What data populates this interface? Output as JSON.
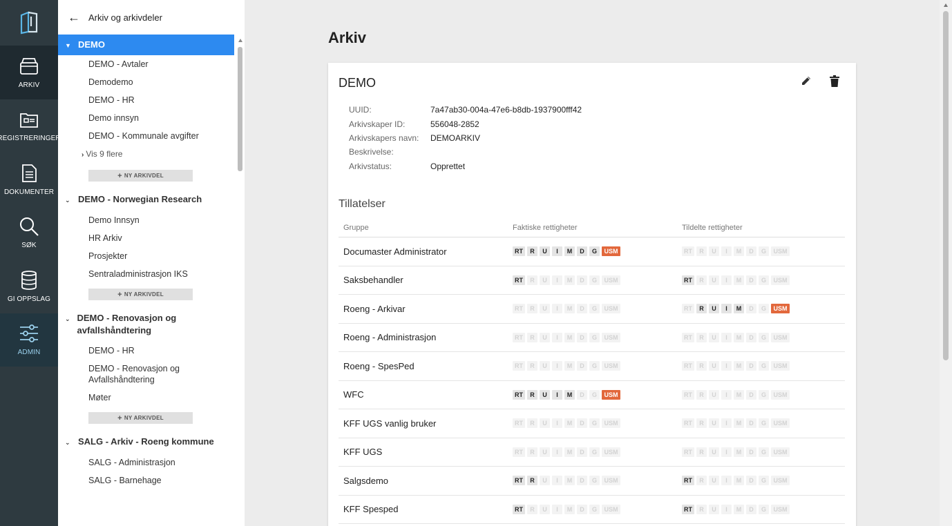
{
  "rail": {
    "items": [
      {
        "label": "ARKIV",
        "icon": "archive-box-icon"
      },
      {
        "label": "REGISTRERINGER",
        "icon": "folder-doc-icon"
      },
      {
        "label": "DOKUMENTER",
        "icon": "document-icon"
      },
      {
        "label": "SØK",
        "icon": "search-icon"
      },
      {
        "label": "GI OPPSLAG",
        "icon": "database-icon"
      },
      {
        "label": "ADMIN",
        "icon": "sliders-icon"
      }
    ]
  },
  "tree": {
    "header": "Arkiv og arkivdeler",
    "new_label": "NY ARKIVDEL",
    "groups": [
      {
        "title": "DEMO",
        "items": [
          "DEMO - Avtaler",
          "Demodemo",
          "DEMO - HR",
          "Demo innsyn",
          "DEMO - Kommunale avgifter"
        ],
        "more": "Vis 9 flere"
      },
      {
        "title": "DEMO - Norwegian Research",
        "items": [
          "Demo Innsyn",
          "HR Arkiv",
          "Prosjekter",
          "Sentraladministrasjon IKS"
        ]
      },
      {
        "title": "DEMO - Renovasjon og avfallshåndtering",
        "items": [
          "DEMO - HR",
          "DEMO - Renovasjon og Avfallshåndtering",
          "Møter"
        ]
      },
      {
        "title": "SALG - Arkiv - Roeng kommune",
        "items": [
          "SALG - Administrasjon",
          "SALG - Barnehage"
        ]
      }
    ]
  },
  "main": {
    "page_title": "Arkiv",
    "card_title": "DEMO",
    "meta": [
      {
        "key": "UUID:",
        "value": "7a47ab30-004a-47e6-b8db-1937900fff42"
      },
      {
        "key": "Arkivskaper ID:",
        "value": "556048-2852"
      },
      {
        "key": "Arkivskapers navn:",
        "value": "DEMOARKIV"
      },
      {
        "key": "Beskrivelse:",
        "value": ""
      },
      {
        "key": "Arkivstatus:",
        "value": "Opprettet"
      }
    ],
    "permissions_title": "Tillatelser",
    "columns": [
      "Gruppe",
      "Faktiske rettigheter",
      "Tildelte rettigheter"
    ],
    "badge_labels": [
      "RT",
      "R",
      "U",
      "I",
      "M",
      "D",
      "G",
      "USM"
    ],
    "rows": [
      {
        "group": "Documaster Administrator",
        "actual": [
          1,
          1,
          1,
          1,
          1,
          1,
          1,
          1
        ],
        "assigned": [
          0,
          0,
          0,
          0,
          0,
          0,
          0,
          0
        ]
      },
      {
        "group": "Saksbehandler",
        "actual": [
          1,
          0,
          0,
          0,
          0,
          0,
          0,
          0
        ],
        "assigned": [
          1,
          0,
          0,
          0,
          0,
          0,
          0,
          0
        ]
      },
      {
        "group": "Roeng - Arkivar",
        "actual": [
          0,
          0,
          0,
          0,
          0,
          0,
          0,
          0
        ],
        "assigned": [
          0,
          1,
          1,
          1,
          1,
          0,
          0,
          1
        ]
      },
      {
        "group": "Roeng - Administrasjon",
        "actual": [
          0,
          0,
          0,
          0,
          0,
          0,
          0,
          0
        ],
        "assigned": [
          0,
          0,
          0,
          0,
          0,
          0,
          0,
          0
        ]
      },
      {
        "group": "Roeng - SpesPed",
        "actual": [
          0,
          0,
          0,
          0,
          0,
          0,
          0,
          0
        ],
        "assigned": [
          0,
          0,
          0,
          0,
          0,
          0,
          0,
          0
        ]
      },
      {
        "group": "WFC",
        "actual": [
          1,
          1,
          1,
          1,
          1,
          0,
          0,
          1
        ],
        "assigned": [
          0,
          0,
          0,
          0,
          0,
          0,
          0,
          0
        ]
      },
      {
        "group": "KFF UGS vanlig bruker",
        "actual": [
          0,
          0,
          0,
          0,
          0,
          0,
          0,
          0
        ],
        "assigned": [
          0,
          0,
          0,
          0,
          0,
          0,
          0,
          0
        ]
      },
      {
        "group": "KFF UGS",
        "actual": [
          0,
          0,
          0,
          0,
          0,
          0,
          0,
          0
        ],
        "assigned": [
          0,
          0,
          0,
          0,
          0,
          0,
          0,
          0
        ]
      },
      {
        "group": "Salgsdemo",
        "actual": [
          1,
          1,
          0,
          0,
          0,
          0,
          0,
          0
        ],
        "assigned": [
          1,
          0,
          0,
          0,
          0,
          0,
          0,
          0
        ]
      },
      {
        "group": "KFF Spesped",
        "actual": [
          1,
          0,
          0,
          0,
          0,
          0,
          0,
          0
        ],
        "assigned": [
          1,
          0,
          0,
          0,
          0,
          0,
          0,
          0
        ]
      }
    ]
  }
}
